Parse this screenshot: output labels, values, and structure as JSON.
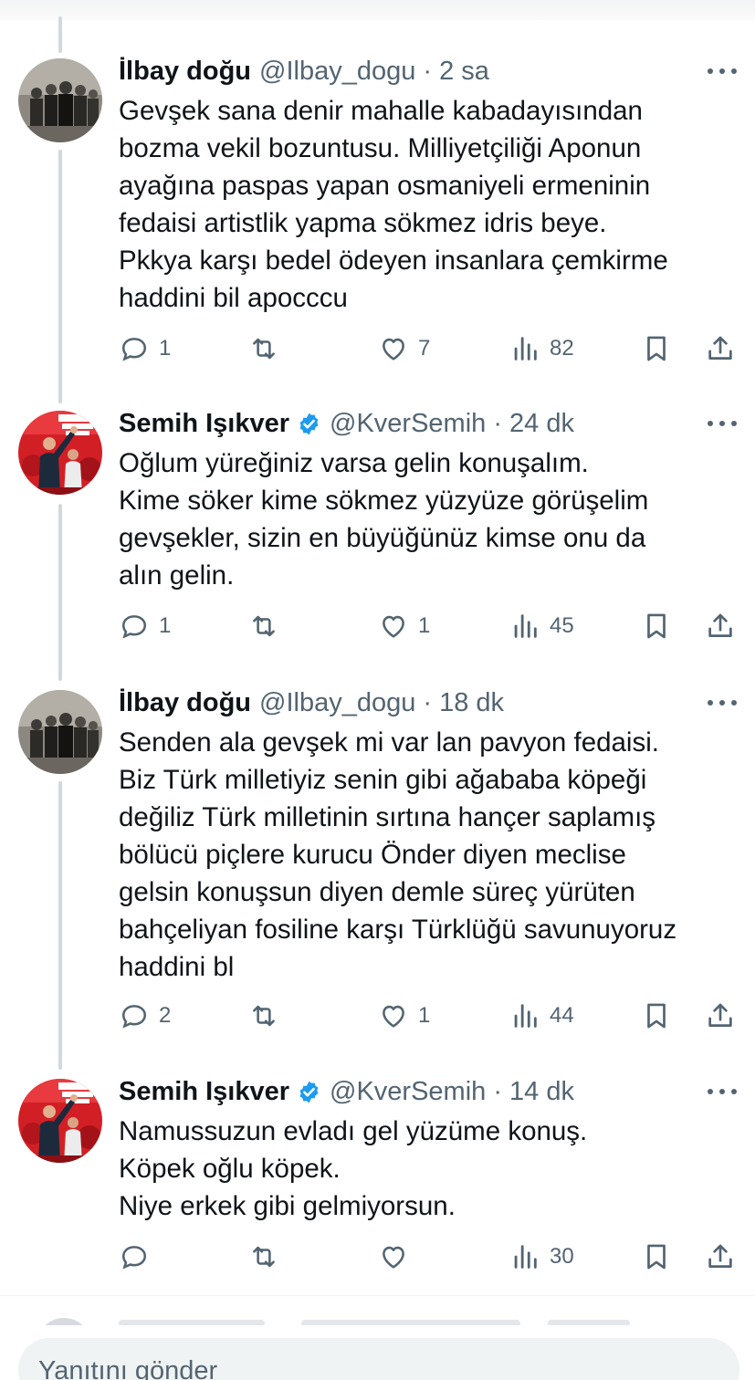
{
  "tweets": [
    {
      "name": "İlbay doğu",
      "handle_time": "@Ilbay_dogu · 2 sa",
      "verified": false,
      "lines": [
        "Gevşek sana denir mahalle kabadayısından",
        "bozma vekil bozuntusu. Milliyetçiliği Aponun",
        "ayağına paspas yapan osmaniyeli ermeninin",
        "fedaisi artistlik yapma sökmez idris beye.",
        "Pkkya karşı bedel ödeyen insanlara çemkirme",
        "haddini bil apocccu"
      ],
      "replies": "1",
      "retweets": "",
      "likes": "7",
      "views": "82"
    },
    {
      "name": "Semih Işıkver",
      "handle_time": "@KverSemih · 24 dk",
      "verified": true,
      "lines": [
        "Oğlum yüreğiniz varsa gelin konuşalım.",
        "Kime söker kime sökmez yüzyüze görüşelim",
        "gevşekler, sizin en büyüğünüz kimse onu da",
        "alın gelin."
      ],
      "replies": "1",
      "retweets": "",
      "likes": "1",
      "views": "45"
    },
    {
      "name": "İlbay doğu",
      "handle_time": "@Ilbay_dogu · 18 dk",
      "verified": false,
      "lines": [
        "Senden ala gevşek mi var lan pavyon fedaisi.",
        "Biz Türk milletiyiz senin gibi ağababa köpeği",
        "değiliz Türk milletinin sırtına hançer saplamış",
        "bölücü piçlere kurucu Önder diyen meclise",
        "gelsin konuşsun diyen demle süreç yürüten",
        "bahçeliyan fosiline karşı Türklüğü savunuyoruz",
        "haddini bl"
      ],
      "replies": "2",
      "retweets": "",
      "likes": "1",
      "views": "44"
    },
    {
      "name": "Semih Işıkver",
      "handle_time": "@KverSemih · 14 dk",
      "verified": true,
      "lines": [
        "Namussuzun evladı gel yüzüme konuş.",
        "Köpek oğlu köpek.",
        "Niye erkek gibi gelmiyorsun."
      ],
      "replies": "",
      "retweets": "",
      "likes": "",
      "views": "30"
    }
  ],
  "reply_box": {
    "placeholder": "Yanıtını gönder"
  },
  "icons": {
    "reply": "reply-icon",
    "retweet": "retweet-icon",
    "like": "heart-icon",
    "views": "views-icon",
    "bookmark": "bookmark-icon",
    "share": "share-icon",
    "more": "more-icon",
    "verified": "verified-badge-icon"
  },
  "colors": {
    "text": "#0f1419",
    "secondary": "#536471",
    "verified": "#1d9bf0",
    "thread_line": "#cfd9de",
    "reply_bg": "#eff3f4"
  }
}
